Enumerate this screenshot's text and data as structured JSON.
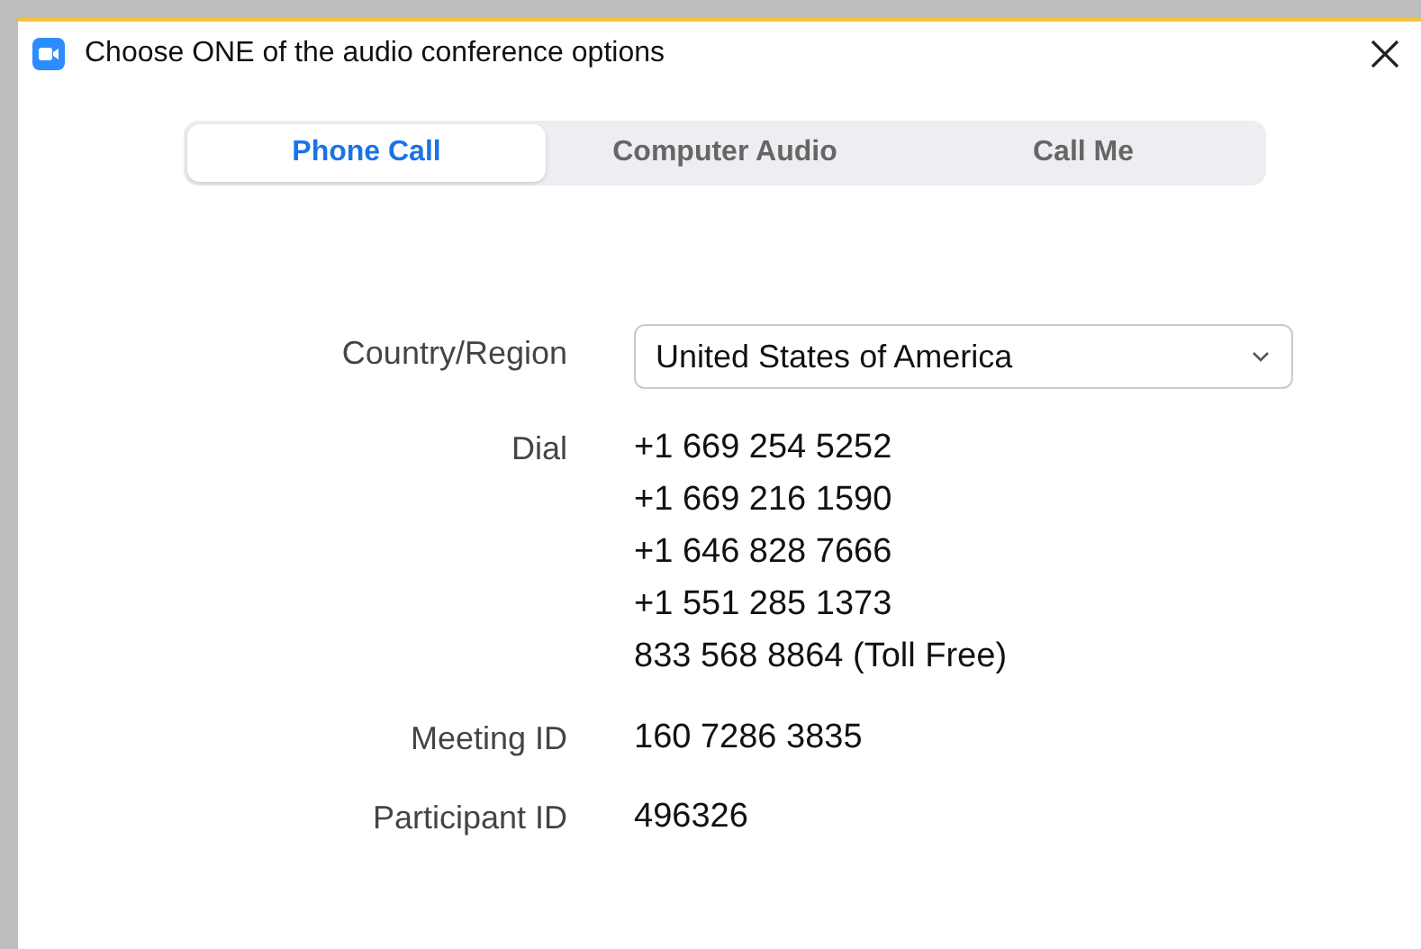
{
  "window": {
    "title": "Choose ONE of the audio conference options"
  },
  "tabs": [
    {
      "label": "Phone Call",
      "selected": true
    },
    {
      "label": "Computer Audio",
      "selected": false
    },
    {
      "label": "Call Me",
      "selected": false
    }
  ],
  "country": {
    "label": "Country/Region",
    "value": "United States of America"
  },
  "dial": {
    "label": "Dial",
    "numbers": [
      "+1 669 254 5252",
      "+1 669 216 1590",
      "+1 646 828 7666",
      "+1 551 285 1373",
      "833 568 8864 (Toll Free)"
    ]
  },
  "meeting_id": {
    "label": "Meeting ID",
    "value": "160 7286 3835"
  },
  "participant_id": {
    "label": "Participant ID",
    "value": "496326"
  }
}
